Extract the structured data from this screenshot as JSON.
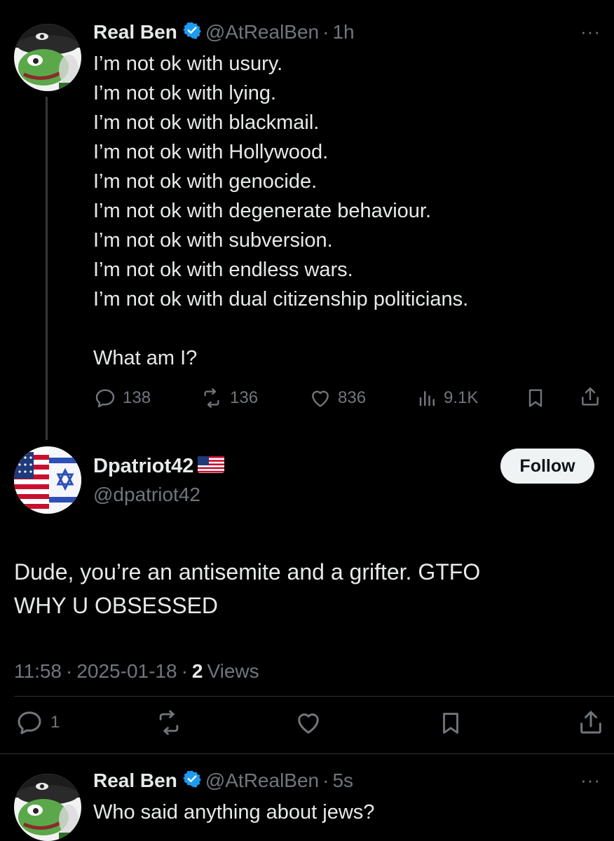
{
  "post1": {
    "display_name": "Real Ben",
    "handle": "@AtRealBen",
    "separator": "·",
    "time": "1h",
    "more": "···",
    "lines": [
      "I’m not ok with usury.",
      "I’m not ok with lying.",
      "I’m not ok with blackmail.",
      "I’m not ok with Hollywood.",
      "I’m not ok with genocide.",
      "I’m not ok with degenerate behaviour.",
      "I’m not ok with subversion.",
      "I’m not ok with endless wars.",
      "I’m not ok with dual citizenship politicians."
    ],
    "question": "What am I?",
    "replies": "138",
    "reposts": "136",
    "likes": "836",
    "views": "9.1K"
  },
  "post2": {
    "display_name": "Dpatriot42",
    "handle": "@dpatriot42",
    "follow_label": "Follow",
    "body_line1": "Dude, you’re an antisemite and a grifter. GTFO",
    "body_line2": "WHY U OBSESSED",
    "time": "11:58",
    "separator": "·",
    "date": "2025-01-18",
    "views_count": "2",
    "views_label": "Views",
    "replies": "1"
  },
  "post3": {
    "display_name": "Real Ben",
    "handle": "@AtRealBen",
    "separator": "·",
    "time": "5s",
    "more": "···",
    "text": "Who said anything about jews?"
  },
  "colors": {
    "background": "#000000",
    "text": "#e7e9ea",
    "muted": "#71767b",
    "verified": "#1d9bf0",
    "follow_bg": "#eff3f4"
  }
}
